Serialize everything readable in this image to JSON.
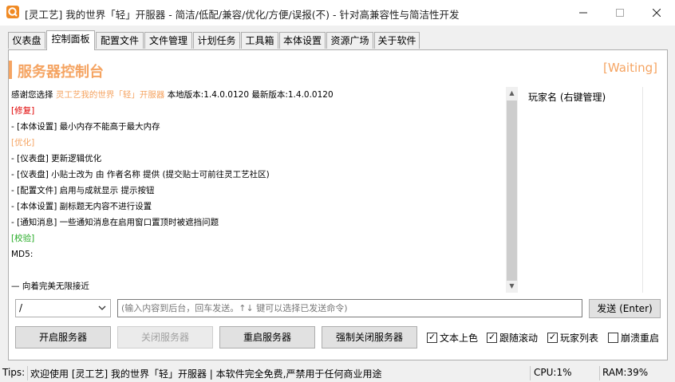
{
  "window": {
    "title": "[灵工艺] 我的世界「轻」开服器 - 简洁/低配/兼容/优化/方便/误报(不) - 针对高兼容性与简洁性开发"
  },
  "tabs": [
    "仪表盘",
    "控制面板",
    "配置文件",
    "文件管理",
    "计划任务",
    "工具箱",
    "本体设置",
    "资源广场",
    "关于软件"
  ],
  "active_tab": "控制面板",
  "header": {
    "title": "服务器控制台",
    "status": "[Waiting]"
  },
  "colors": {
    "accent": "#f5a462",
    "fix": "#e00000",
    "optimize": "#f5a462",
    "verify": "#22aa22"
  },
  "log": {
    "line0_prefix": "感谢您选择 ",
    "line0_highlight": "灵工艺我的世界「轻」开服器",
    "line0_suffix": " 本地版本:1.4.0.0120 最新版本:1.4.0.0120",
    "lines": [
      "[修复]",
      "- [本体设置] 最小内存不能高于最大内存",
      "[优化]",
      "- [仪表盘] 更新逻辑优化",
      "- [仪表盘] 小贴士改为 由 作者名称 提供 (提交贴士可前往灵工艺社区)",
      "- [配置文件] 启用与成就显示 提示按钮",
      "- [本体设置] 副标题无内容不进行设置",
      "- [通知消息] 一些通知消息在启用窗口置顶时被遮挡问题",
      "[校验]",
      "MD5:",
      "",
      "— 向着完美无限接近"
    ]
  },
  "player_list": {
    "header": "玩家名 (右键管理)"
  },
  "command": {
    "prefix_value": "/",
    "placeholder": "(输入内容到后台，回车发送。↑↓ 键可以选择已发送命令)",
    "send_label": "发送 (Enter)"
  },
  "buttons": {
    "start": "开启服务器",
    "stop": "关闭服务器",
    "restart": "重启服务器",
    "force_stop": "强制关闭服务器"
  },
  "options": [
    {
      "label": "文本上色",
      "checked": true
    },
    {
      "label": "跟随滚动",
      "checked": true
    },
    {
      "label": "玩家列表",
      "checked": true
    },
    {
      "label": "崩溃重启",
      "checked": false
    }
  ],
  "status_bar": {
    "tips_label": "Tips:",
    "tips_text": "欢迎使用 [灵工艺] 我的世界「轻」开服器 | 本软件完全免费,严禁用于任何商业用途",
    "cpu": "CPU:1%",
    "ram": "RAM:39%"
  }
}
